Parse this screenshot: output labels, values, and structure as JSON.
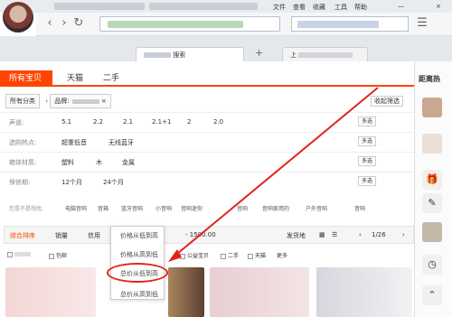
{
  "browser": {
    "menu": [
      "文件",
      "查看",
      "收藏",
      "工具",
      "帮助"
    ],
    "nav_back": "‹",
    "nav_forward": "›",
    "nav_refresh": "↻",
    "nav_home": "⌂",
    "tab_title": "搜索",
    "tab_new": "+",
    "tab_right": "上",
    "min_btn": "—",
    "close_btn": "×"
  },
  "category_tabs": [
    "所有宝贝",
    "天猫",
    "二手"
  ],
  "breadcrumb": {
    "all": "所有分类",
    "brand": "品牌:",
    "collapse": "收起筛选"
  },
  "filters": [
    {
      "label": "声道:",
      "options": [
        "5.1",
        "2.2",
        "2.1",
        "2.1+1",
        "2",
        "2.0"
      ],
      "more": "多选"
    },
    {
      "label": "选购热点:",
      "options": [
        "超重低音",
        "无线蓝牙"
      ],
      "more": "多选"
    },
    {
      "label": "箱体材质:",
      "options": [
        "塑料",
        "木",
        "金属"
      ],
      "more": "多选"
    },
    {
      "label": "保修期:",
      "options": [
        "12个月",
        "24个月"
      ],
      "more": "多选"
    }
  ],
  "suggest": {
    "label": "您是不是想找:",
    "items": [
      "电脑音响",
      "音箱",
      "蓝牙音响",
      "小音响",
      "音响迷你",
      "音响",
      "音响家用的",
      "户外音响",
      "音响"
    ]
  },
  "sortbar": {
    "items": [
      "综合排序",
      "销量",
      "信用"
    ],
    "price_range": "- 1500.00",
    "ship_from": "发货地",
    "page": "1/26"
  },
  "dropdown": {
    "items": [
      "价格从低到高",
      "价格从高到低",
      "总价从低到高",
      "总价从高到低"
    ]
  },
  "checks": [
    "消费者保障",
    "包邮",
    "赠送退货运费险",
    "公益宝贝",
    "二手",
    "天猫"
  ],
  "checks_more": "更多",
  "right_sidebar": {
    "label1": "距离热"
  },
  "colors": {
    "accent": "#ff4400",
    "annotation": "#e2231a"
  }
}
